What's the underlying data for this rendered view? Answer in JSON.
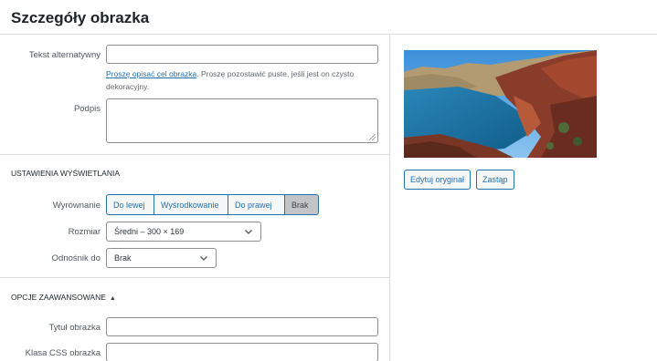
{
  "header": {
    "title": "Szczegóły obrazka"
  },
  "form": {
    "alt_label": "Tekst alternatywny",
    "alt_value": "",
    "help_link": "Proszę opisać cel obrazka",
    "help_text": ". Proszę pozostawić puste, jeśli jest on czysto dekoracyjny.",
    "caption_label": "Podpis",
    "caption_value": ""
  },
  "display": {
    "section_title": "USTAWIENIA WYŚWIETLANIA",
    "align_label": "Wyrównanie",
    "align_options": [
      "Do lewej",
      "Wyśrodkowanie",
      "Do prawej",
      "Brak"
    ],
    "align_selected": "Brak",
    "size_label": "Rozmiar",
    "size_value": "Średni – 300 × 169",
    "link_label": "Odnośnik do",
    "link_value": "Brak"
  },
  "advanced": {
    "section_title": "OPCJE ZAAWANSOWANE",
    "toggle_icon": "triangle-up-icon",
    "title_label": "Tytuł obrazka",
    "title_value": "",
    "css_label": "Klasa CSS obrazka",
    "css_value": ""
  },
  "preview": {
    "edit_button": "Edytuj oryginał",
    "replace_button": "Zastąp"
  },
  "colors": {
    "accent": "#2271b1",
    "active_segment": "#c3c4c7",
    "border": "#dcdcde"
  }
}
